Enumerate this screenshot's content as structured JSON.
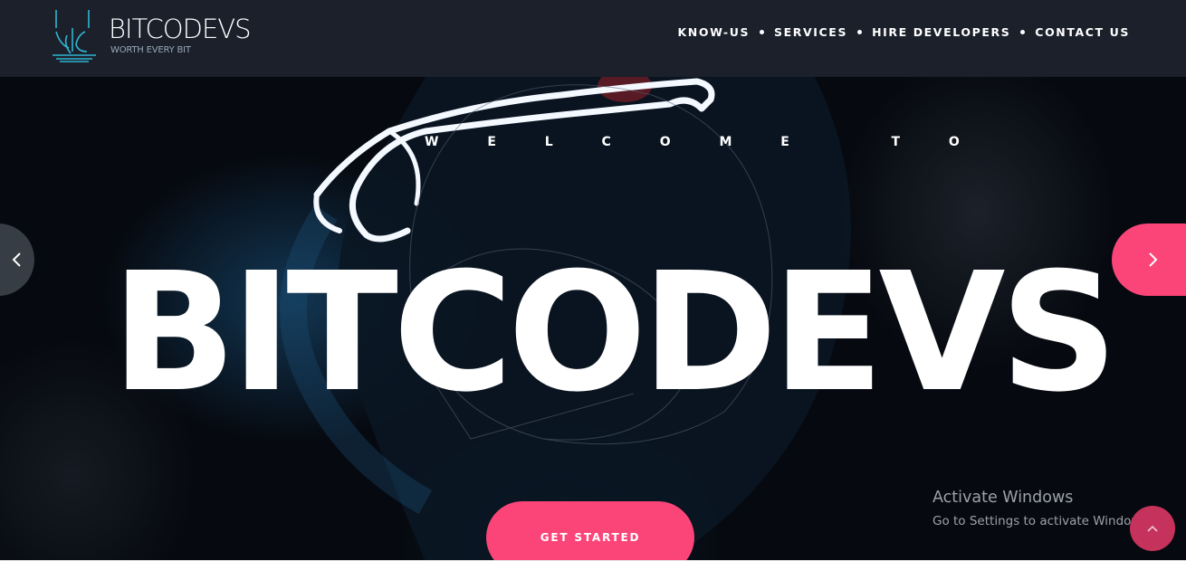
{
  "header": {
    "brand_name": "BITCODEVS",
    "brand_tagline": "WORTH EVERY BIT",
    "nav": [
      {
        "label": "KNOW-US"
      },
      {
        "label": "SERVICES"
      },
      {
        "label": "HIRE DEVELOPERS"
      },
      {
        "label": "CONTACT US"
      }
    ]
  },
  "hero": {
    "welcome": "W E L C O M E   T O",
    "title": "BITCODEVS",
    "cta_label": "GET STARTED",
    "prev_icon": "chevron-left-icon",
    "next_icon": "chevron-right-icon"
  },
  "watermark": {
    "title": "Activate Windows",
    "subtitle": "Go to Settings to activate Windows."
  },
  "scroll_top": {
    "icon": "chevron-up-icon"
  },
  "colors": {
    "header_bg": "#1b202b",
    "accent_pink": "#fb4579",
    "logo_cyan": "#2fb6d1",
    "hero_bg": "#06090f"
  }
}
